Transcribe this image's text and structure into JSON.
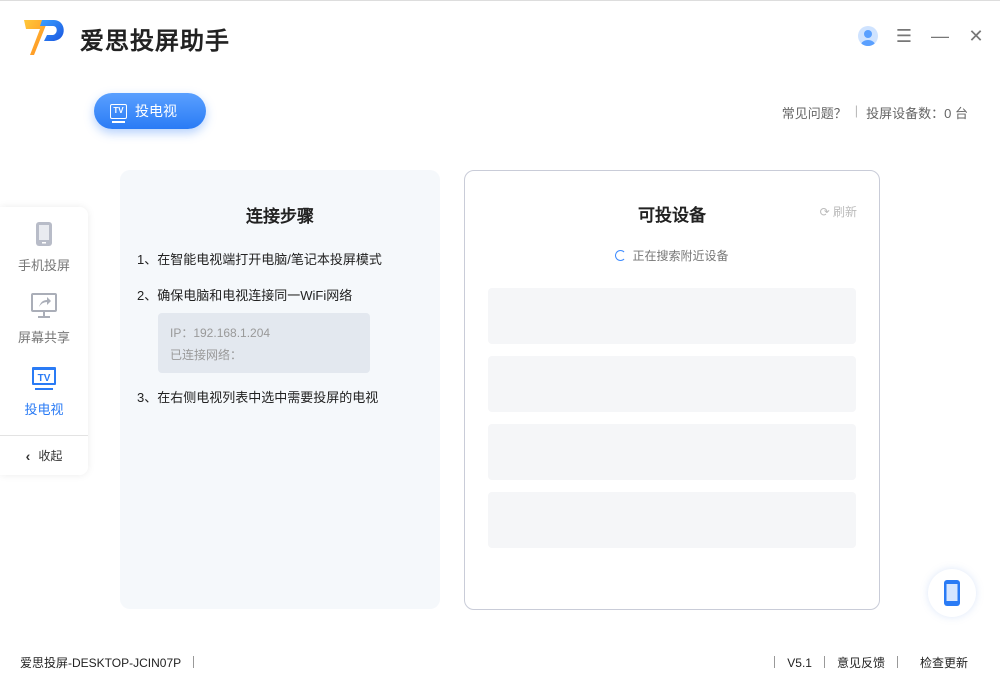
{
  "app": {
    "title": "爱思投屏助手"
  },
  "header": {
    "faq": "常见问题？",
    "device_count_label": "投屏设备数：",
    "device_count": "0",
    "device_unit": "台"
  },
  "mode_button": {
    "icon_text": "TV",
    "label": "投电视"
  },
  "sidebar": {
    "items": [
      {
        "label": "手机投屏"
      },
      {
        "label": "屏幕共享"
      },
      {
        "label": "投电视"
      }
    ],
    "collapse": "收起"
  },
  "steps": {
    "title": "连接步骤",
    "step1": "1、在智能电视端打开电脑/笔记本投屏模式",
    "step2": "2、确保电脑和电视连接同一WiFi网络",
    "ip": "IP：192.168.1.204",
    "network": "已连接网络：",
    "step3": "3、在右侧电视列表中选中需要投屏的电视"
  },
  "devices": {
    "title": "可投设备",
    "refresh": "刷新",
    "status": "正在搜索附近设备"
  },
  "footer": {
    "device_name": "爱思投屏-DESKTOP-JCIN07P",
    "version": "V5.1",
    "feedback": "意见反馈",
    "update": "检查更新"
  },
  "colors": {
    "accent": "#2a7bf5"
  }
}
